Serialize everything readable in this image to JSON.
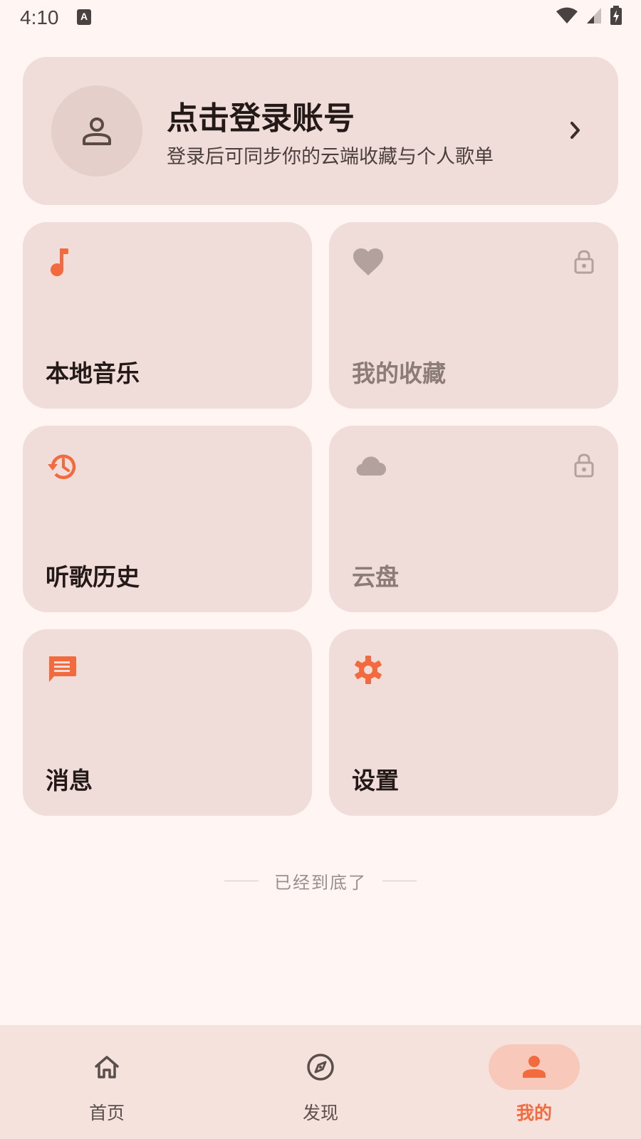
{
  "status": {
    "time": "4:10",
    "notif_glyph": "A"
  },
  "login": {
    "title": "点击登录账号",
    "subtitle": "登录后可同步你的云端收藏与个人歌单"
  },
  "cards": [
    {
      "label": "本地音乐",
      "icon": "music-note-icon",
      "locked": false
    },
    {
      "label": "我的收藏",
      "icon": "heart-icon",
      "locked": true
    },
    {
      "label": "听歌历史",
      "icon": "history-icon",
      "locked": false
    },
    {
      "label": "云盘",
      "icon": "cloud-icon",
      "locked": true
    },
    {
      "label": "消息",
      "icon": "message-icon",
      "locked": false
    },
    {
      "label": "设置",
      "icon": "gear-icon",
      "locked": false
    }
  ],
  "end_text": "已经到底了",
  "nav": [
    {
      "label": "首页",
      "icon": "home-icon",
      "active": false
    },
    {
      "label": "发现",
      "icon": "compass-icon",
      "active": false
    },
    {
      "label": "我的",
      "icon": "person-icon",
      "active": true
    }
  ],
  "colors": {
    "accent": "#F26A3D",
    "card_bg": "#F0DCD8",
    "page_bg": "#FFF6F4",
    "muted_icon": "#B3A19D",
    "nav_bg": "#F5E2DD",
    "nav_active_pill": "#F8C9BA"
  }
}
